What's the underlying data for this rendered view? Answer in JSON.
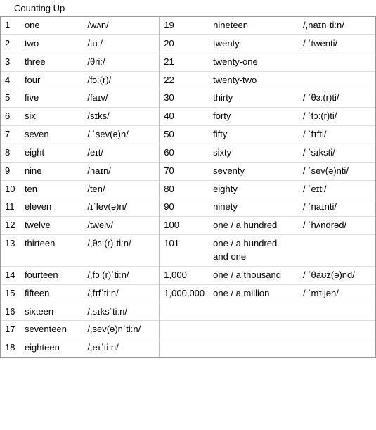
{
  "title": "Counting Up",
  "left_rows": [
    {
      "num": "1",
      "word": "one",
      "pron": "/wʌn/"
    },
    {
      "num": "2",
      "word": "two",
      "pron": "/tuː/"
    },
    {
      "num": "3",
      "word": "three",
      "pron": "/θriː/"
    },
    {
      "num": "4",
      "word": "four",
      "pron": "/fɔː(r)/"
    },
    {
      "num": "5",
      "word": "five",
      "pron": "/faɪv/"
    },
    {
      "num": "6",
      "word": "six",
      "pron": "/sɪks/"
    },
    {
      "num": "7",
      "word": "seven",
      "pron": "/ ˈsev(ə)n/"
    },
    {
      "num": "8",
      "word": "eight",
      "pron": "/eɪt/"
    },
    {
      "num": "9",
      "word": "nine",
      "pron": "/naɪn/"
    },
    {
      "num": "10",
      "word": "ten",
      "pron": "/ten/"
    },
    {
      "num": "11",
      "word": "eleven",
      "pron": "/ɪˈlev(ə)n/"
    },
    {
      "num": "12",
      "word": "twelve",
      "pron": "/twelv/"
    },
    {
      "num": "13",
      "word": "thirteen",
      "pron": "/,θɜː(r)ˈtiːn/"
    },
    {
      "num": "14",
      "word": "fourteen",
      "pron": "/,fɔː(r)ˈtiːn/"
    },
    {
      "num": "15",
      "word": "fifteen",
      "pron": "/,fɪfˈtiːn/"
    },
    {
      "num": "16",
      "word": "sixteen",
      "pron": "/,sɪksˈtiːn/"
    },
    {
      "num": "17",
      "word": "seventeen",
      "pron": "/,sev(ə)nˈtiːn/"
    },
    {
      "num": "18",
      "word": "eighteen",
      "pron": "/,eɪˈtiːn/"
    }
  ],
  "right_rows": [
    {
      "num": "19",
      "word": "nineteen",
      "pron": "/,naɪnˈtiːn/"
    },
    {
      "num": "20",
      "word": "twenty",
      "pron": "/ ˈtwenti/"
    },
    {
      "num": "21",
      "word": "twenty-one",
      "pron": ""
    },
    {
      "num": "22",
      "word": "twenty-two",
      "pron": ""
    },
    {
      "num": "30",
      "word": "thirty",
      "pron": "/ ˈθɜː(r)ti/"
    },
    {
      "num": "40",
      "word": "forty",
      "pron": "/ ˈfɔː(r)ti/"
    },
    {
      "num": "50",
      "word": "fifty",
      "pron": "/ ˈfɪfti/"
    },
    {
      "num": "60",
      "word": "sixty",
      "pron": "/ ˈsɪksti/"
    },
    {
      "num": "70",
      "word": "seventy",
      "pron": "/ ˈsev(ə)nti/"
    },
    {
      "num": "80",
      "word": "eighty",
      "pron": "/ ˈeɪti/"
    },
    {
      "num": "90",
      "word": "ninety",
      "pron": "/ ˈnaɪnti/"
    },
    {
      "num": "100",
      "word": "one / a hundred",
      "pron": "/ ˈhʌndrəd/"
    },
    {
      "num": "101",
      "word": "one / a hundred and one",
      "pron": ""
    },
    {
      "num": "1,000",
      "word": "one / a thousand",
      "pron": "/ ˈθaʊz(ə)nd/"
    },
    {
      "num": "1,000,000",
      "word": "one / a million",
      "pron": "/ ˈmɪljən/"
    }
  ]
}
